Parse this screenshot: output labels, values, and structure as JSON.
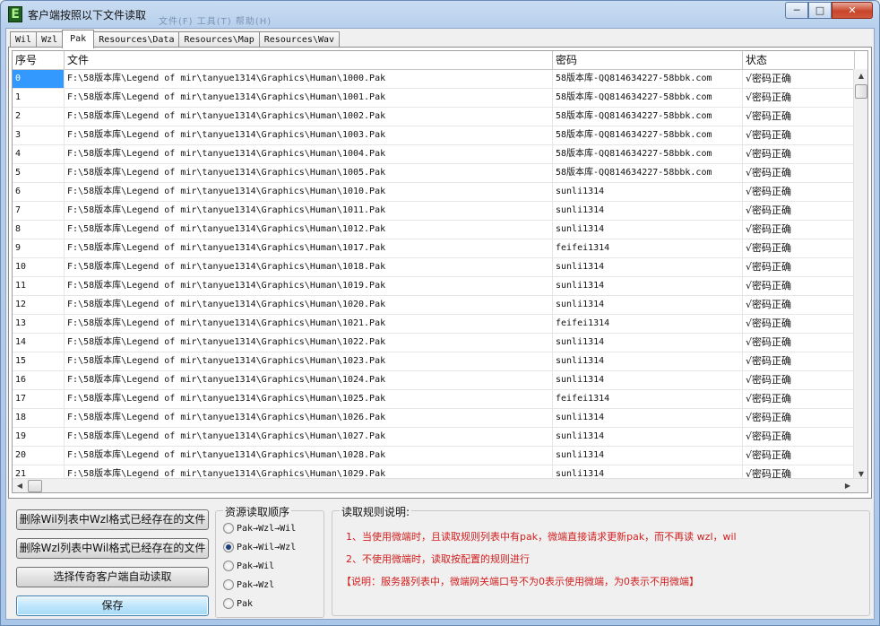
{
  "window": {
    "title": "客户端按照以下文件读取",
    "title_ghost": "文件(F)    工具(T)    帮助(H)",
    "min_glyph": "─",
    "max_glyph": "□",
    "close_glyph": "✕",
    "icon_letter": "E"
  },
  "tabs": [
    {
      "label": "Wil"
    },
    {
      "label": "Wzl"
    },
    {
      "label": "Pak"
    },
    {
      "label": "Resources\\Data"
    },
    {
      "label": "Resources\\Map"
    },
    {
      "label": "Resources\\Wav"
    }
  ],
  "grid": {
    "headers": [
      "序号",
      "文件",
      "密码",
      "状态"
    ],
    "rows": [
      [
        "0",
        "F:\\58版本库\\Legend of mir\\tanyue1314\\Graphics\\Human\\1000.Pak",
        "58版本库-QQ814634227-58bbk.com",
        "√密码正确"
      ],
      [
        "1",
        "F:\\58版本库\\Legend of mir\\tanyue1314\\Graphics\\Human\\1001.Pak",
        "58版本库-QQ814634227-58bbk.com",
        "√密码正确"
      ],
      [
        "2",
        "F:\\58版本库\\Legend of mir\\tanyue1314\\Graphics\\Human\\1002.Pak",
        "58版本库-QQ814634227-58bbk.com",
        "√密码正确"
      ],
      [
        "3",
        "F:\\58版本库\\Legend of mir\\tanyue1314\\Graphics\\Human\\1003.Pak",
        "58版本库-QQ814634227-58bbk.com",
        "√密码正确"
      ],
      [
        "4",
        "F:\\58版本库\\Legend of mir\\tanyue1314\\Graphics\\Human\\1004.Pak",
        "58版本库-QQ814634227-58bbk.com",
        "√密码正确"
      ],
      [
        "5",
        "F:\\58版本库\\Legend of mir\\tanyue1314\\Graphics\\Human\\1005.Pak",
        "58版本库-QQ814634227-58bbk.com",
        "√密码正确"
      ],
      [
        "6",
        "F:\\58版本库\\Legend of mir\\tanyue1314\\Graphics\\Human\\1010.Pak",
        "sunli1314",
        "√密码正确"
      ],
      [
        "7",
        "F:\\58版本库\\Legend of mir\\tanyue1314\\Graphics\\Human\\1011.Pak",
        "sunli1314",
        "√密码正确"
      ],
      [
        "8",
        "F:\\58版本库\\Legend of mir\\tanyue1314\\Graphics\\Human\\1012.Pak",
        "sunli1314",
        "√密码正确"
      ],
      [
        "9",
        "F:\\58版本库\\Legend of mir\\tanyue1314\\Graphics\\Human\\1017.Pak",
        "feifei1314",
        "√密码正确"
      ],
      [
        "10",
        "F:\\58版本库\\Legend of mir\\tanyue1314\\Graphics\\Human\\1018.Pak",
        "sunli1314",
        "√密码正确"
      ],
      [
        "11",
        "F:\\58版本库\\Legend of mir\\tanyue1314\\Graphics\\Human\\1019.Pak",
        "sunli1314",
        "√密码正确"
      ],
      [
        "12",
        "F:\\58版本库\\Legend of mir\\tanyue1314\\Graphics\\Human\\1020.Pak",
        "sunli1314",
        "√密码正确"
      ],
      [
        "13",
        "F:\\58版本库\\Legend of mir\\tanyue1314\\Graphics\\Human\\1021.Pak",
        "feifei1314",
        "√密码正确"
      ],
      [
        "14",
        "F:\\58版本库\\Legend of mir\\tanyue1314\\Graphics\\Human\\1022.Pak",
        "sunli1314",
        "√密码正确"
      ],
      [
        "15",
        "F:\\58版本库\\Legend of mir\\tanyue1314\\Graphics\\Human\\1023.Pak",
        "sunli1314",
        "√密码正确"
      ],
      [
        "16",
        "F:\\58版本库\\Legend of mir\\tanyue1314\\Graphics\\Human\\1024.Pak",
        "sunli1314",
        "√密码正确"
      ],
      [
        "17",
        "F:\\58版本库\\Legend of mir\\tanyue1314\\Graphics\\Human\\1025.Pak",
        "feifei1314",
        "√密码正确"
      ],
      [
        "18",
        "F:\\58版本库\\Legend of mir\\tanyue1314\\Graphics\\Human\\1026.Pak",
        "sunli1314",
        "√密码正确"
      ],
      [
        "19",
        "F:\\58版本库\\Legend of mir\\tanyue1314\\Graphics\\Human\\1027.Pak",
        "sunli1314",
        "√密码正确"
      ],
      [
        "20",
        "F:\\58版本库\\Legend of mir\\tanyue1314\\Graphics\\Human\\1028.Pak",
        "sunli1314",
        "√密码正确"
      ],
      [
        "21",
        "F:\\58版本库\\Legend of mir\\tanyue1314\\Graphics\\Human\\1029.Pak",
        "sunli1314",
        "√密码正确"
      ]
    ]
  },
  "buttons": {
    "delete_wil": "删除Wil列表中Wzl格式已经存在的文件",
    "delete_wzl": "删除Wzl列表中Wil格式已经存在的文件",
    "auto_read": "选择传奇客户端自动读取",
    "save": "保存"
  },
  "order": {
    "legend": "资源读取顺序",
    "options": [
      {
        "label": "Pak→Wzl→Wil",
        "checked": false
      },
      {
        "label": "Pak→Wil→Wzl",
        "checked": true
      },
      {
        "label": "Pak→Wil",
        "checked": false
      },
      {
        "label": "Pak→Wzl",
        "checked": false
      },
      {
        "label": "Pak",
        "checked": false
      }
    ]
  },
  "rules": {
    "legend": "读取规则说明:",
    "line1": "1、当使用微端时，且读取规则列表中有pak，微端直接请求更新pak，而不再读 wzl，wil",
    "line2": "2、不使用微端时，读取按配置的规则进行",
    "line3": "【说明：服务器列表中，微端网关端口号不为0表示使用微端，为0表示不用微端】"
  },
  "scroll": {
    "up": "▲",
    "down": "▼",
    "left": "◀",
    "right": "▶"
  },
  "colors": {
    "selection": "#3399ff",
    "rule_text": "#d21f1f"
  }
}
